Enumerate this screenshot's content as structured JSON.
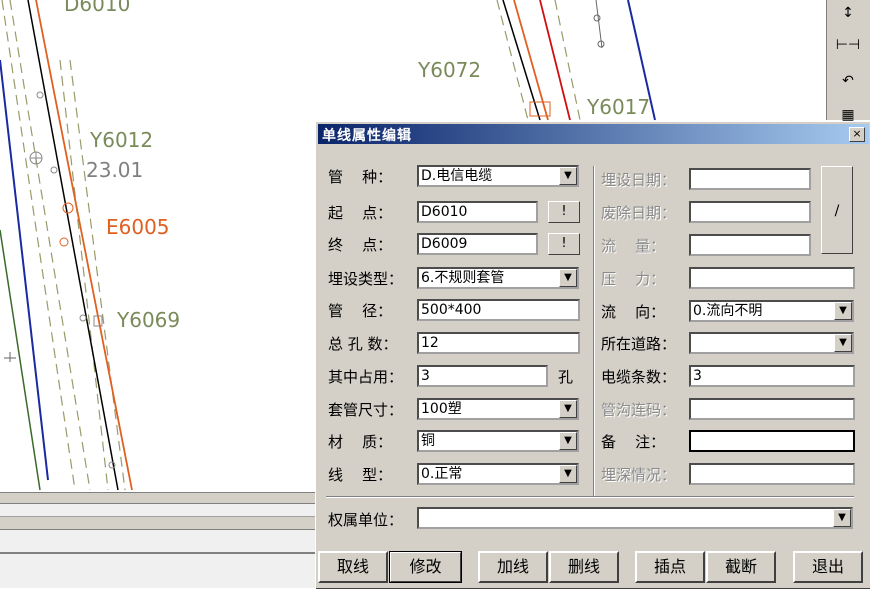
{
  "map": {
    "labels": {
      "d6010": "D6010",
      "y6072": "Y6072",
      "y6017": "Y6017",
      "y6012": "Y6012",
      "elev": "23.01",
      "e6005": "E6005",
      "y6069": "Y6069"
    }
  },
  "colors": {
    "titlebar": "#0a246a",
    "dialog_bg": "#d4d0c8",
    "orange_label": "#e06020",
    "olive_label": "#7a8a5a"
  },
  "dialog": {
    "title": "单线属性编辑",
    "close_icon": "close-icon",
    "fields": {
      "pipe_type": {
        "label": "管    种：",
        "value": "D.电信电缆"
      },
      "start_point": {
        "label": "起    点：",
        "value": "D6010",
        "btn": "!"
      },
      "end_point": {
        "label": "终    点：",
        "value": "D6009",
        "btn": "!"
      },
      "burial_type": {
        "label": "埋设类型：",
        "value": "6.不规则套管"
      },
      "diameter": {
        "label": "管    径：",
        "value": "500*400"
      },
      "total_holes": {
        "label": "总 孔 数：",
        "value": "12"
      },
      "occupied": {
        "label": "其中占用：",
        "value": "3",
        "unit": "孔"
      },
      "sleeve_size": {
        "label": "套管尺寸：",
        "value": "100塑"
      },
      "material": {
        "label": "材    质：",
        "value": "铜"
      },
      "line_type": {
        "label": "线    型：",
        "value": "0.正常"
      },
      "burial_date": {
        "label": "埋设日期：",
        "value": ""
      },
      "removal_date": {
        "label": "废除日期：",
        "value": ""
      },
      "flow": {
        "label": "流    量：",
        "value": ""
      },
      "pressure": {
        "label": "压    力：",
        "value": ""
      },
      "flow_dir": {
        "label": "流    向：",
        "value": "0.流向不明"
      },
      "road": {
        "label": "所在道路：",
        "value": ""
      },
      "cable_count": {
        "label": "电缆条数：",
        "value": "3"
      },
      "trench_code": {
        "label": "管沟连码：",
        "value": ""
      },
      "remark": {
        "label": "备    注：",
        "value": ""
      },
      "depth_status": {
        "label": "埋深情况：",
        "value": ""
      },
      "owner": {
        "label": "权属单位：",
        "value": ""
      }
    },
    "side_button": "/",
    "buttons": {
      "pick_line": "取线",
      "modify": "修改",
      "add_line": "加线",
      "delete_line": "删线",
      "insert_point": "插点",
      "cut": "截断",
      "exit": "退出"
    }
  }
}
